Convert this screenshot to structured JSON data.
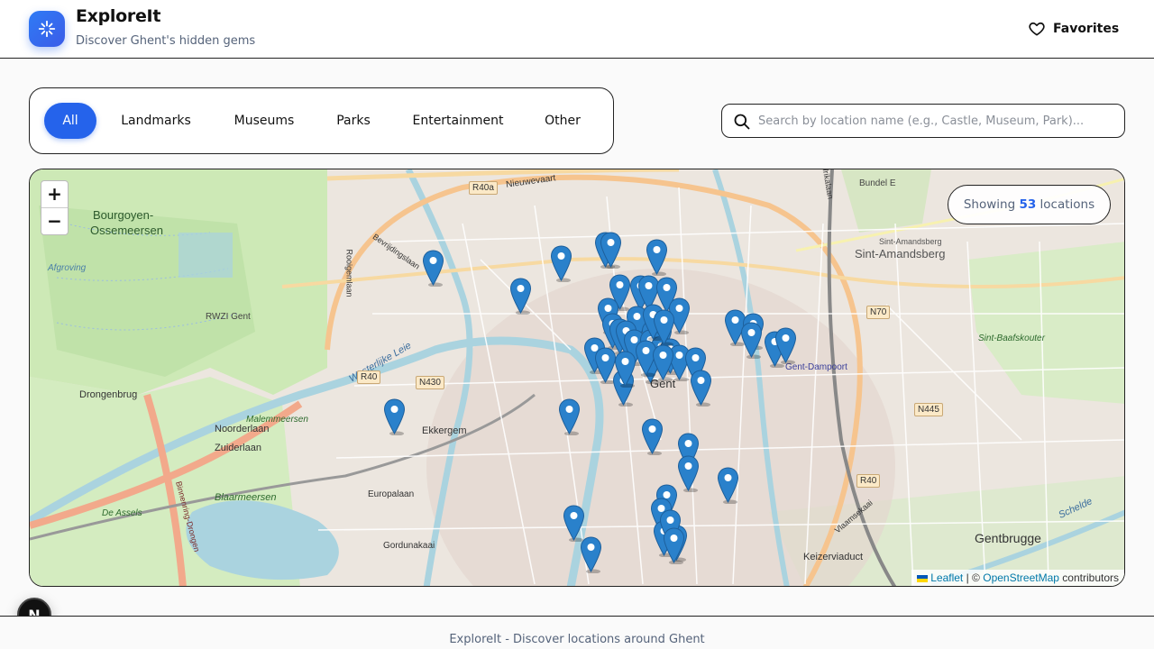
{
  "app": {
    "title": "ExploreIt",
    "subtitle": "Discover Ghent's hidden gems",
    "favorites_label": "Favorites"
  },
  "filters": {
    "active": "All",
    "items": [
      "All",
      "Landmarks",
      "Museums",
      "Parks",
      "Entertainment",
      "Other"
    ]
  },
  "search": {
    "placeholder": "Search by location name (e.g., Castle, Museum, Park)...",
    "value": ""
  },
  "map": {
    "zoom_in": "+",
    "zoom_out": "−",
    "showing_prefix": "Showing",
    "showing_count": "53",
    "showing_suffix": "locations",
    "attribution": {
      "leaflet": "Leaflet",
      "separator": "| ©",
      "osm": "OpenStreetMap",
      "contributors": "contributors"
    },
    "labels": {
      "bourgoyen": "Bourgoyen-",
      "ossemeersen": "Ossemeersen",
      "afgroving": "Afgroving",
      "rwzi": "RWZI Gent",
      "drongenbrug": "Drongenbrug",
      "noorderlaan": "Noorderlaan",
      "zuiderlaan": "Zuiderlaan",
      "malemmeersen": "Malemmeersen",
      "ekkergem": "Ekkergem",
      "de_assels": "De Assels",
      "blaarmeersen": "Blaarmeersen",
      "europalaan": "Europalaan",
      "gordunakaai": "Gordunakaai",
      "sint_amandsberg": "Sint-Amandsberg",
      "sint_amandsberg_small": "Sint-Amandsberg",
      "sint_baafskouter": "Sint-Baafskouter",
      "gent_dampoort": "Gent-Dampoort",
      "gentbrugge": "Gentbrugge",
      "keizerviaduct": "Keizerviaduct",
      "nieuwevaart": "Nieuwevaart",
      "bevrijdingslaan": "Bevrijdingslaan",
      "westerlijke_leie": "Westerlijke Leie",
      "bundel_e": "Bundel E",
      "afrikalaan": "Afrikalaan",
      "gent": "Gent",
      "vlaamsekaai": "Vlaamsekaai",
      "schelde": "Schelde",
      "binnenring": "Binnenring-Drongen",
      "rooigemlaan": "Rooigemlaan"
    },
    "road_badges": [
      "R40a",
      "R40",
      "N430",
      "N70",
      "N445",
      "R40"
    ]
  },
  "footer": {
    "text": "ExploreIt - Discover locations around Ghent"
  },
  "colors": {
    "accent": "#2563eb",
    "marker": "#2a81cb",
    "muted_text": "#55637a"
  },
  "icons": {
    "logo": "sparkle-icon",
    "favorites": "heart-icon",
    "search": "search-icon",
    "marker": "map-pin-icon",
    "next_badge": "n-logo-icon"
  }
}
